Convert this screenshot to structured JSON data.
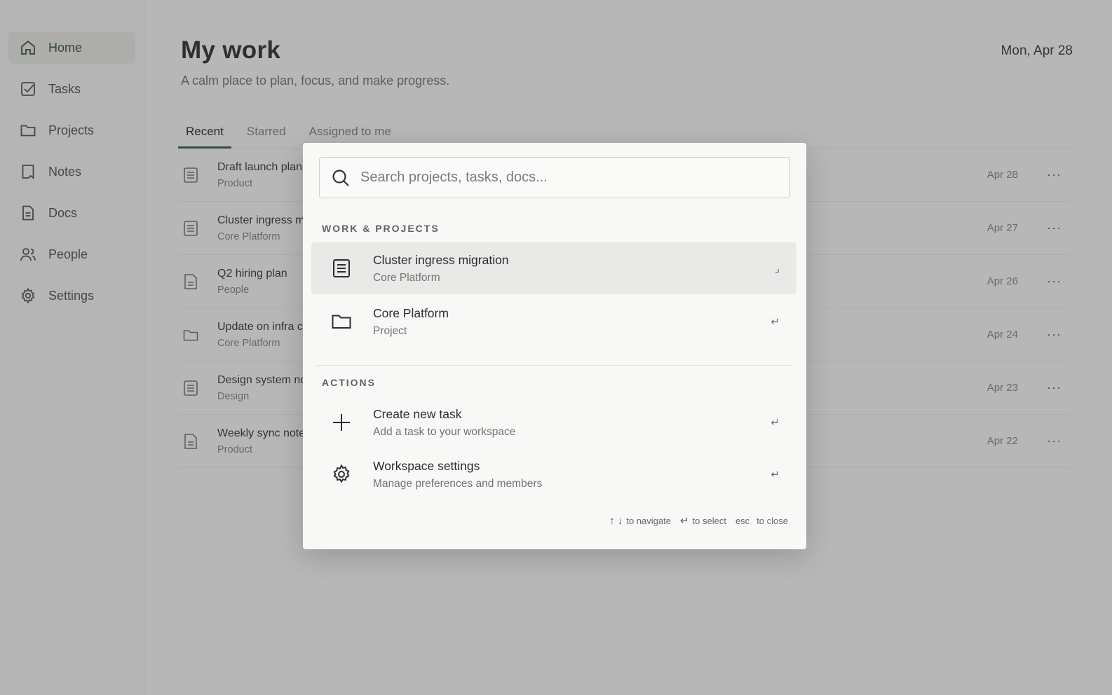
{
  "sidebar": {
    "items": [
      {
        "label": "Home",
        "icon": "home-icon",
        "active": true
      },
      {
        "label": "Tasks",
        "icon": "check-square-icon"
      },
      {
        "label": "Projects",
        "icon": "folder-icon"
      },
      {
        "label": "Notes",
        "icon": "bookmark-icon"
      },
      {
        "label": "Docs",
        "icon": "document-icon"
      },
      {
        "label": "People",
        "icon": "people-icon"
      },
      {
        "label": "Settings",
        "icon": "gear-icon"
      }
    ]
  },
  "header": {
    "title": "My work",
    "subtitle": "A calm place to plan, focus, and make progress.",
    "date": "Mon, Apr 28"
  },
  "tabs": [
    {
      "label": "Recent",
      "active": true
    },
    {
      "label": "Starred"
    },
    {
      "label": "Assigned to me"
    }
  ],
  "rows": [
    {
      "title": "Draft launch plan",
      "sub": "Product",
      "date": "Apr 28",
      "icon": "document-icon"
    },
    {
      "title": "Cluster ingress m",
      "sub": "Core Platform",
      "date": "Apr 27",
      "icon": "document-icon"
    },
    {
      "title": "Q2 hiring plan",
      "sub": "People",
      "date": "Apr 26",
      "icon": "file-icon"
    },
    {
      "title": "Update on infra c",
      "sub": "Core Platform",
      "date": "Apr 24",
      "icon": "folder-icon"
    },
    {
      "title": "Design system no",
      "sub": "Design",
      "date": "Apr 23",
      "icon": "document-icon"
    },
    {
      "title": "Weekly sync note",
      "sub": "Product",
      "date": "Apr 22",
      "icon": "file-icon"
    }
  ],
  "more_label": "···",
  "palette": {
    "search_placeholder": "Search projects, tasks, docs...",
    "sections": {
      "work": "WORK & PROJECTS",
      "actions": "ACTIONS"
    },
    "results": [
      {
        "title": "Cluster ingress migration",
        "sub": "Core Platform",
        "icon": "document-icon",
        "selected": true,
        "enter": "⌟"
      },
      {
        "title": "Core Platform",
        "sub": "Project",
        "icon": "folder-icon",
        "enter": "↵"
      }
    ],
    "actions": [
      {
        "title": "Create new task",
        "sub": "Add a task to your workspace",
        "icon": "plus-icon",
        "enter": "↵"
      },
      {
        "title": "Workspace settings",
        "sub": "Manage preferences and members",
        "icon": "gear-icon",
        "enter": "↵"
      }
    ],
    "footer": {
      "nav_keys": "↑ ↓",
      "nav_text": "to navigate",
      "select_key": "↵",
      "select_text": "to select",
      "close_key": "esc",
      "close_text": "to close"
    }
  },
  "colors": {
    "accent": "#2f5a3f",
    "active_bg": "#e4e6e3",
    "overlay": "rgba(60,60,60,0.33)"
  }
}
